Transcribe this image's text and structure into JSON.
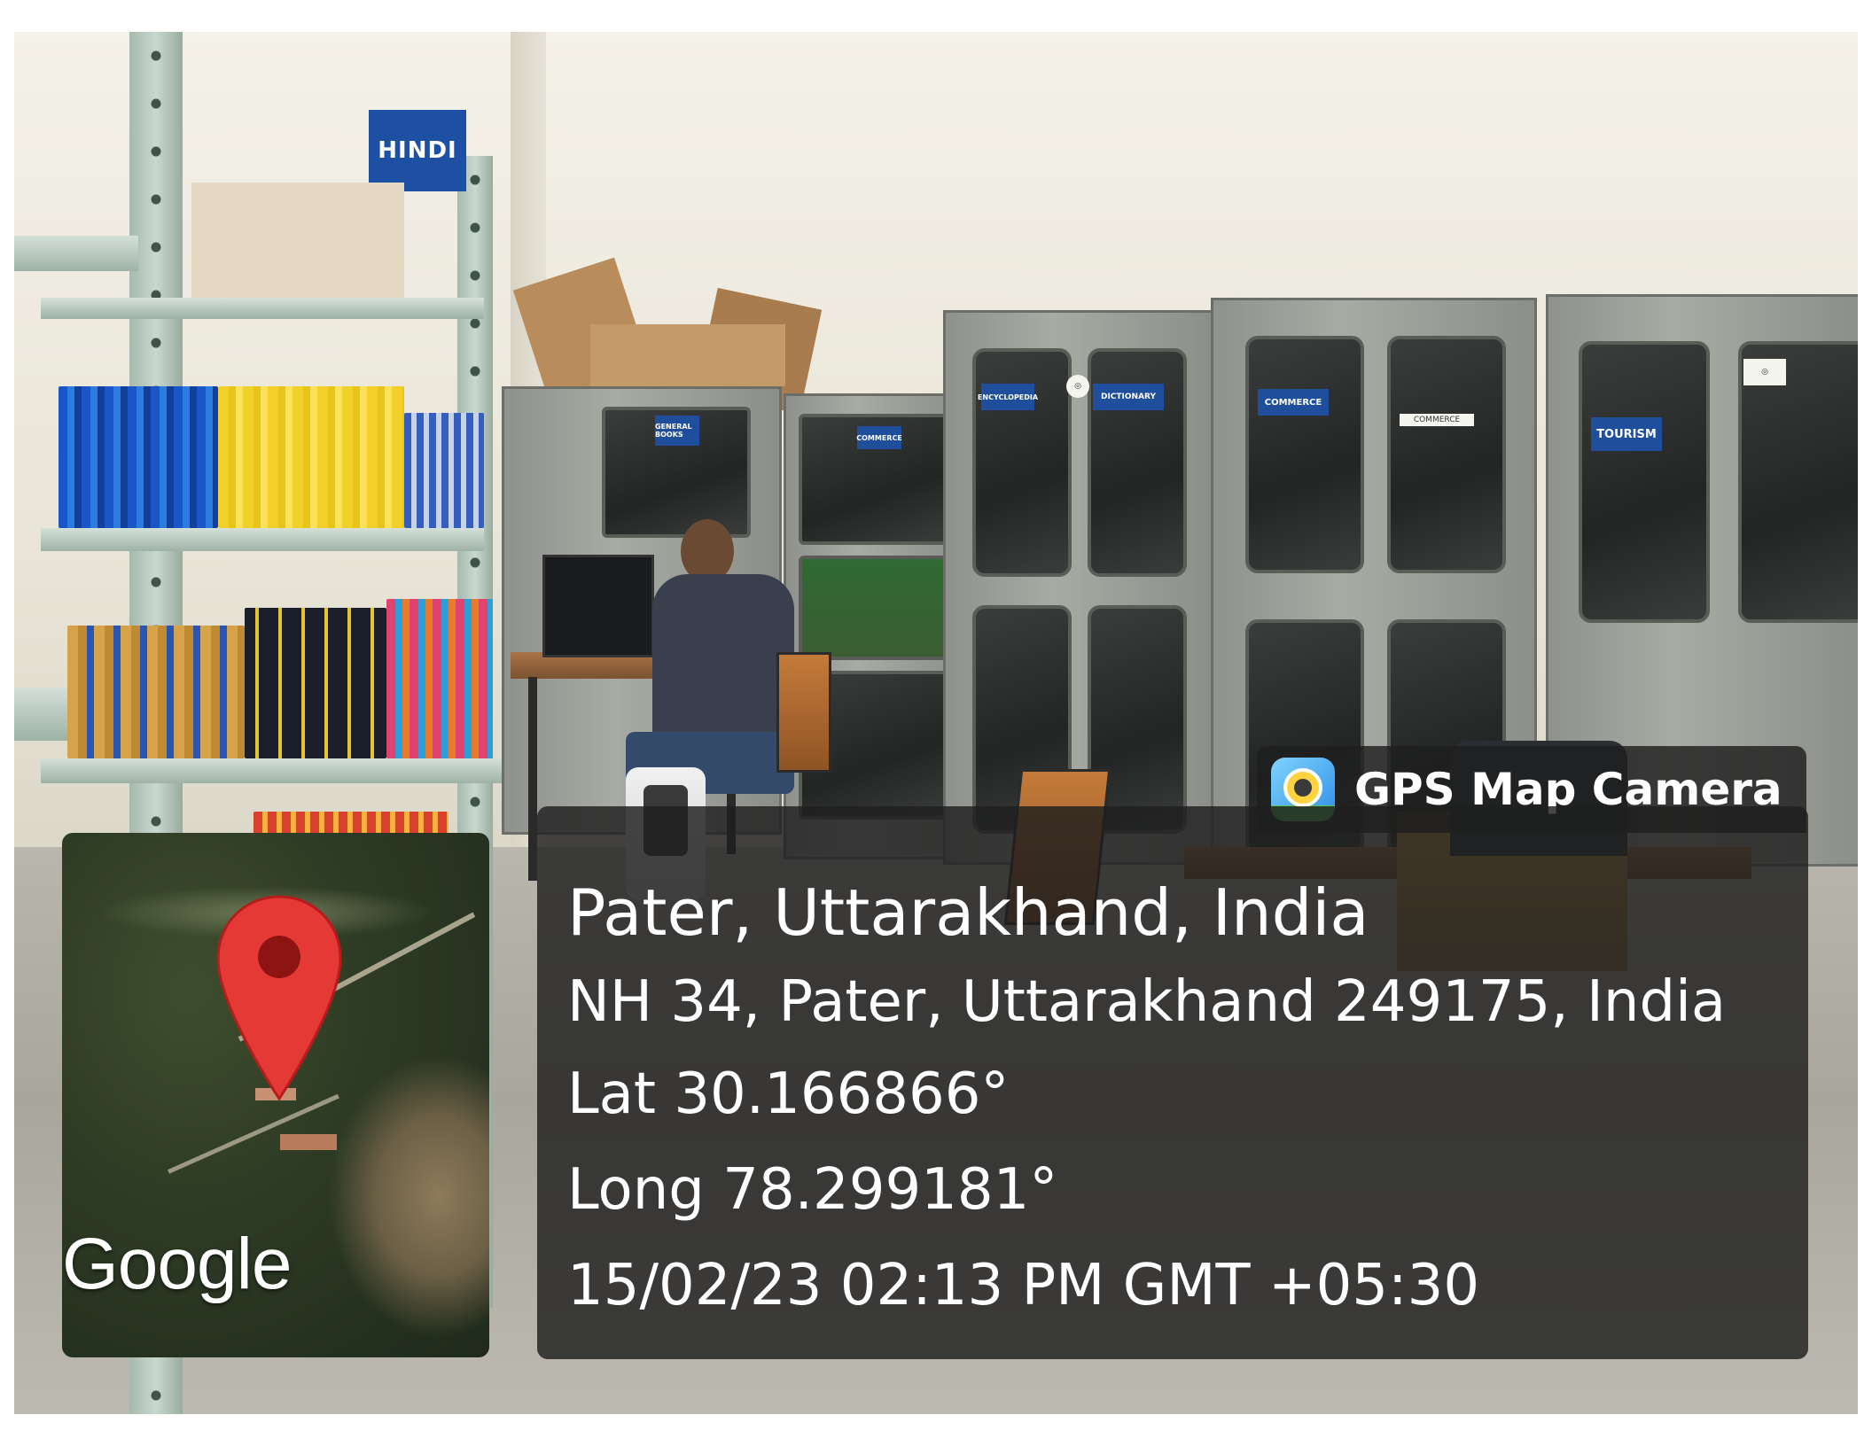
{
  "scene": {
    "signs": {
      "hindi": "HINDI",
      "tourism": "TOURISM",
      "commerce": "COMMERCE",
      "dictionary": "DICTIONARY"
    }
  },
  "overlay": {
    "app_name": "GPS Map Camera",
    "app_icon": "gps-map-camera-icon",
    "map_label": "Google",
    "location_title": "Pater, Uttarakhand, India",
    "address": "NH 34, Pater, Uttarakhand 249175, India",
    "latitude": "Lat 30.166866°",
    "longitude": "Long 78.299181°",
    "timestamp": "15/02/23 02:13 PM GMT +05:30",
    "pin_color": "#e53935"
  }
}
